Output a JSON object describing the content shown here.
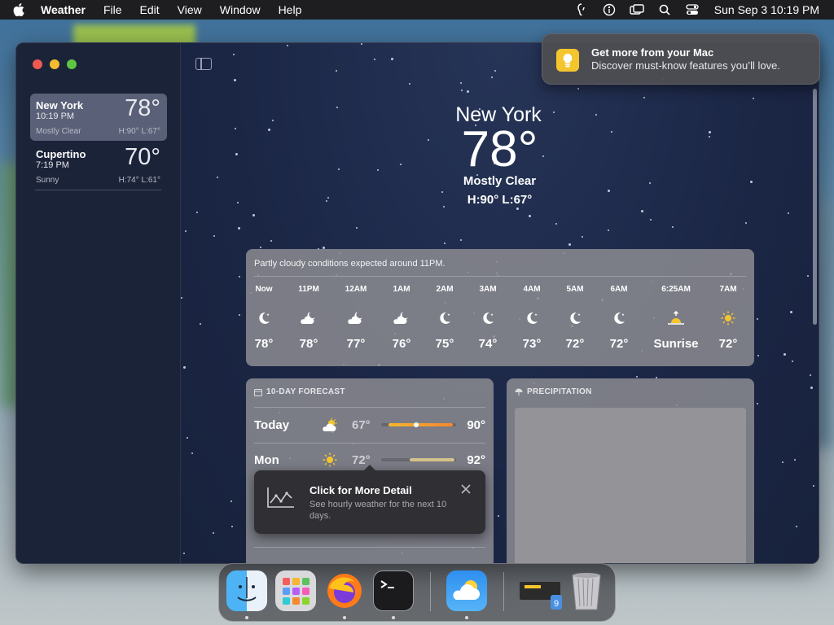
{
  "menubar": {
    "app_name": "Weather",
    "menus": [
      "File",
      "Edit",
      "View",
      "Window",
      "Help"
    ],
    "clock": "Sun Sep 3  10:19 PM",
    "status_icons": [
      "sound-icon",
      "accessibility-icon",
      "screen-mirroring-icon",
      "search-icon",
      "control-center-icon"
    ]
  },
  "notification": {
    "title": "Get more from your Mac",
    "body": "Discover must-know features you’ll love.",
    "icon": "lightbulb-icon"
  },
  "sidebar": {
    "locations": [
      {
        "name": "New York",
        "time": "10:19 PM",
        "temp": "78°",
        "condition": "Mostly Clear",
        "hl": "H:90°  L:67°"
      },
      {
        "name": "Cupertino",
        "time": "7:19 PM",
        "temp": "70°",
        "condition": "Sunny",
        "hl": "H:74°  L:61°"
      }
    ]
  },
  "current": {
    "city": "New York",
    "temp": "78°",
    "condition": "Mostly Clear",
    "hl": "H:90°  L:67°"
  },
  "hourly": {
    "summary": "Partly cloudy conditions expected around 11PM.",
    "hours": [
      {
        "label": "Now",
        "icon": "moon",
        "temp": "78°"
      },
      {
        "label": "11PM",
        "icon": "cloud-moon",
        "temp": "78°"
      },
      {
        "label": "12AM",
        "icon": "cloud-moon",
        "temp": "77°"
      },
      {
        "label": "1AM",
        "icon": "cloud-moon",
        "temp": "76°"
      },
      {
        "label": "2AM",
        "icon": "moon",
        "temp": "75°"
      },
      {
        "label": "3AM",
        "icon": "moon",
        "temp": "74°"
      },
      {
        "label": "4AM",
        "icon": "moon",
        "temp": "73°"
      },
      {
        "label": "5AM",
        "icon": "moon",
        "temp": "72°"
      },
      {
        "label": "6AM",
        "icon": "moon",
        "temp": "72°"
      },
      {
        "label": "6:25AM",
        "icon": "sunrise",
        "temp": "Sunrise"
      },
      {
        "label": "7AM",
        "icon": "sun",
        "temp": "72°"
      }
    ]
  },
  "forecast": {
    "title": "10-DAY FORECAST",
    "days": [
      {
        "day": "Today",
        "icon": "cloud-sun",
        "low": "67°",
        "high": "90°"
      },
      {
        "day": "Mon",
        "icon": "sun",
        "low": "72°",
        "high": "92°"
      }
    ]
  },
  "precipitation": {
    "title": "PRECIPITATION"
  },
  "tooltip": {
    "title": "Click for More Detail",
    "body": "See hourly weather for the next 10 days."
  },
  "dock": {
    "apps": [
      "Finder",
      "Launchpad",
      "Firefox",
      "Terminal",
      "Weather",
      "Downloads",
      "Trash"
    ]
  }
}
